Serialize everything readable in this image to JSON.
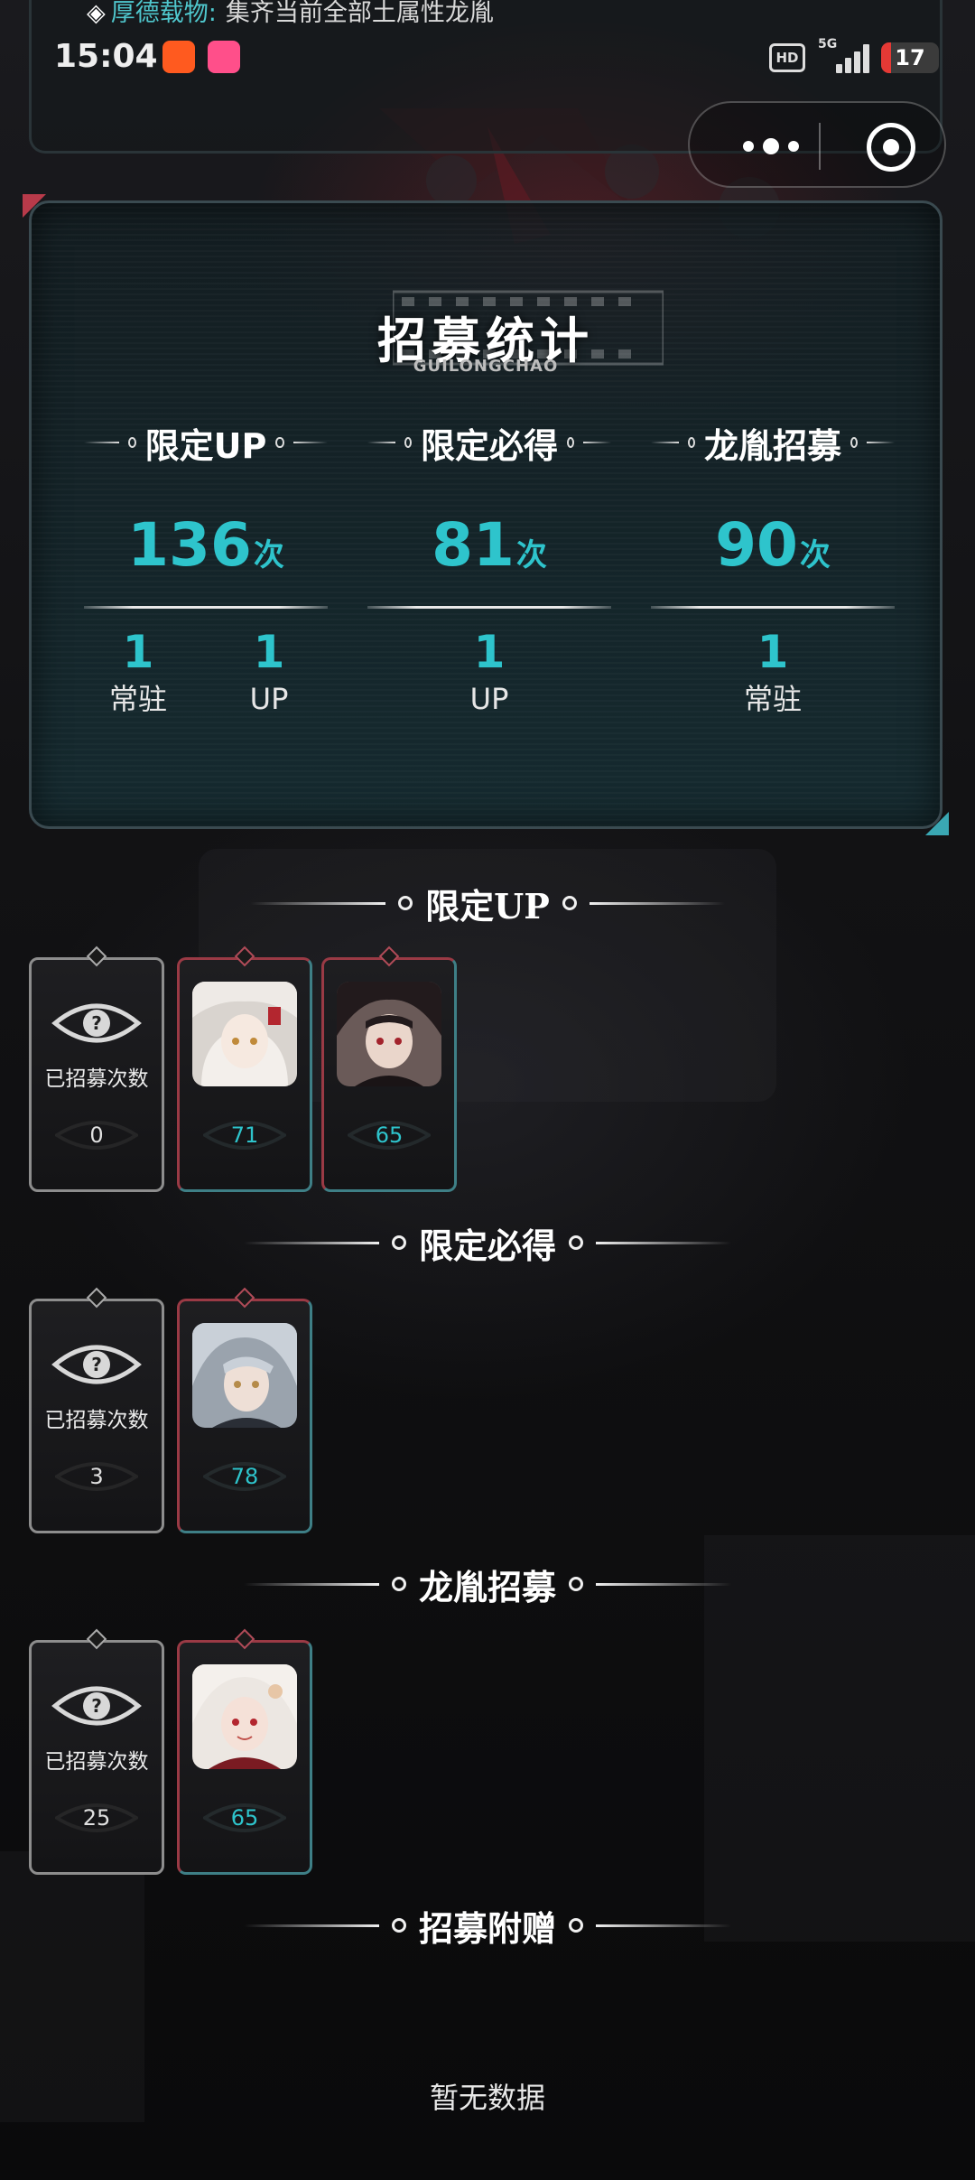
{
  "status_bar": {
    "marquee_key": "厚德载物:",
    "marquee_text": "集齐当前全部土属性龙胤",
    "time": "15:04",
    "app_icon_1": "得物",
    "app_icon_2": "bilibili",
    "hd_label": "HD",
    "network_label": "5G",
    "battery_level": "17"
  },
  "stats": {
    "title": "招募统计",
    "subtitle": "GUILONGCHAO",
    "columns": [
      {
        "label": "限定UP",
        "count": "136",
        "unit": "次",
        "subs": [
          {
            "value": "1",
            "label": "常驻"
          },
          {
            "value": "1",
            "label": "UP"
          }
        ]
      },
      {
        "label": "限定必得",
        "count": "81",
        "unit": "次",
        "subs": [
          {
            "value": "1",
            "label": "UP"
          }
        ]
      },
      {
        "label": "龙胤招募",
        "count": "90",
        "unit": "次",
        "subs": [
          {
            "value": "1",
            "label": "常驻"
          }
        ]
      }
    ]
  },
  "sections": [
    {
      "title": "限定UP",
      "counter": {
        "label": "已招募次数",
        "value": "0"
      },
      "characters": [
        {
          "score": "71",
          "avatar": "white-haired-character-avatar"
        },
        {
          "score": "65",
          "avatar": "dark-haired-character-avatar"
        }
      ]
    },
    {
      "title": "限定必得",
      "counter": {
        "label": "已招募次数",
        "value": "3"
      },
      "characters": [
        {
          "score": "78",
          "avatar": "silver-haired-character-avatar"
        }
      ]
    },
    {
      "title": "龙胤招募",
      "counter": {
        "label": "已招募次数",
        "value": "25"
      },
      "characters": [
        {
          "score": "65",
          "avatar": "pale-haired-character-avatar"
        }
      ]
    },
    {
      "title": "招募附赠",
      "empty_text": "暂无数据"
    }
  ],
  "colors": {
    "accent_cyan": "#2ec4cc",
    "accent_red": "#b83a4a",
    "marquee_key": "#4fc7cd"
  }
}
